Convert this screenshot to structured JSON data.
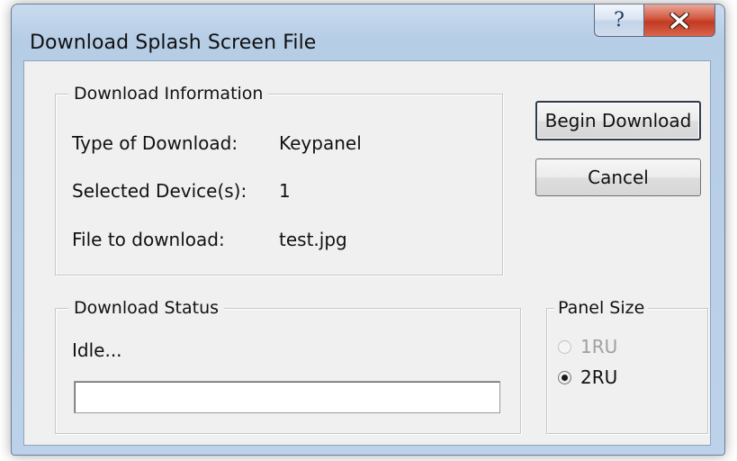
{
  "window": {
    "title": "Download Splash Screen File",
    "help_glyph": "?"
  },
  "download_info": {
    "legend": "Download Information",
    "rows": [
      {
        "label": "Type of Download:",
        "value": "Keypanel"
      },
      {
        "label": "Selected Device(s):",
        "value": "1"
      },
      {
        "label": "File to download:",
        "value": "test.jpg"
      }
    ]
  },
  "buttons": {
    "begin_download": "Begin Download",
    "cancel": "Cancel"
  },
  "download_status": {
    "legend": "Download Status",
    "status_text": "Idle...",
    "progress_fraction": 0
  },
  "panel_size": {
    "legend": "Panel Size",
    "options": [
      {
        "label": "1RU",
        "selected": false,
        "enabled": false
      },
      {
        "label": "2RU",
        "selected": true,
        "enabled": true
      }
    ]
  },
  "colors": {
    "close_button": "#c23a22",
    "dialog_face": "#f0f0f0",
    "frame": "#bdd2ea"
  }
}
